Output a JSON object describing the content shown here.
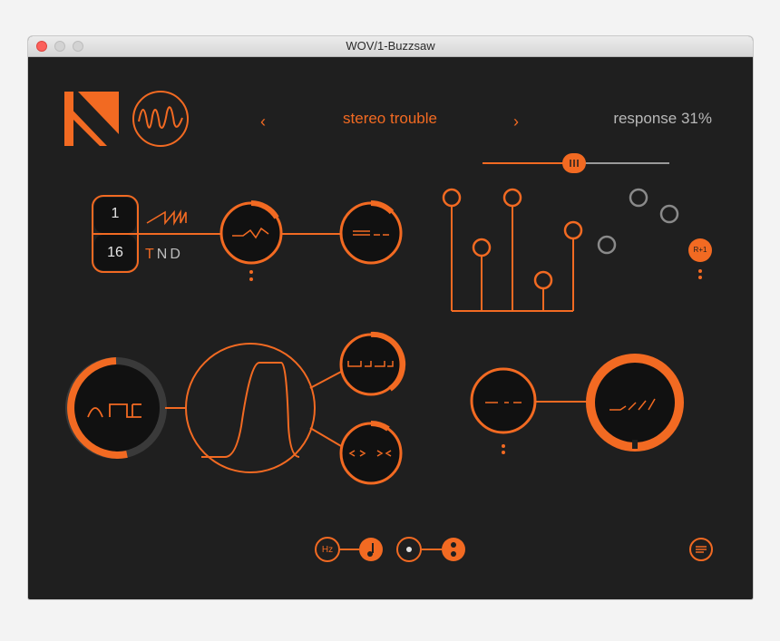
{
  "window": {
    "title": "WOV/1-Buzzsaw"
  },
  "header": {
    "preset_name": "stereo trouble",
    "prev_arrow": "‹",
    "next_arrow": "›",
    "response_label": "response 31%",
    "response_value": 0.31
  },
  "sequencer": {
    "step_top": "1",
    "step_bottom": "16",
    "mode_letters": [
      "T",
      "N",
      "D"
    ],
    "mode_active": "T"
  },
  "badges": {
    "r_plus_one": "R+1"
  },
  "bottom": {
    "hz_label": "Hz"
  },
  "colors": {
    "accent": "#f26a22",
    "background": "#1f1f1f",
    "inactive": "#7a7a7a"
  },
  "icons": {
    "logo": "k-logo-icon",
    "waveform_logo": "waveform-circle-icon",
    "menu": "menu-lines-icon",
    "note": "note-icon",
    "dot": "dot-icon",
    "colon": "colon-icon"
  }
}
